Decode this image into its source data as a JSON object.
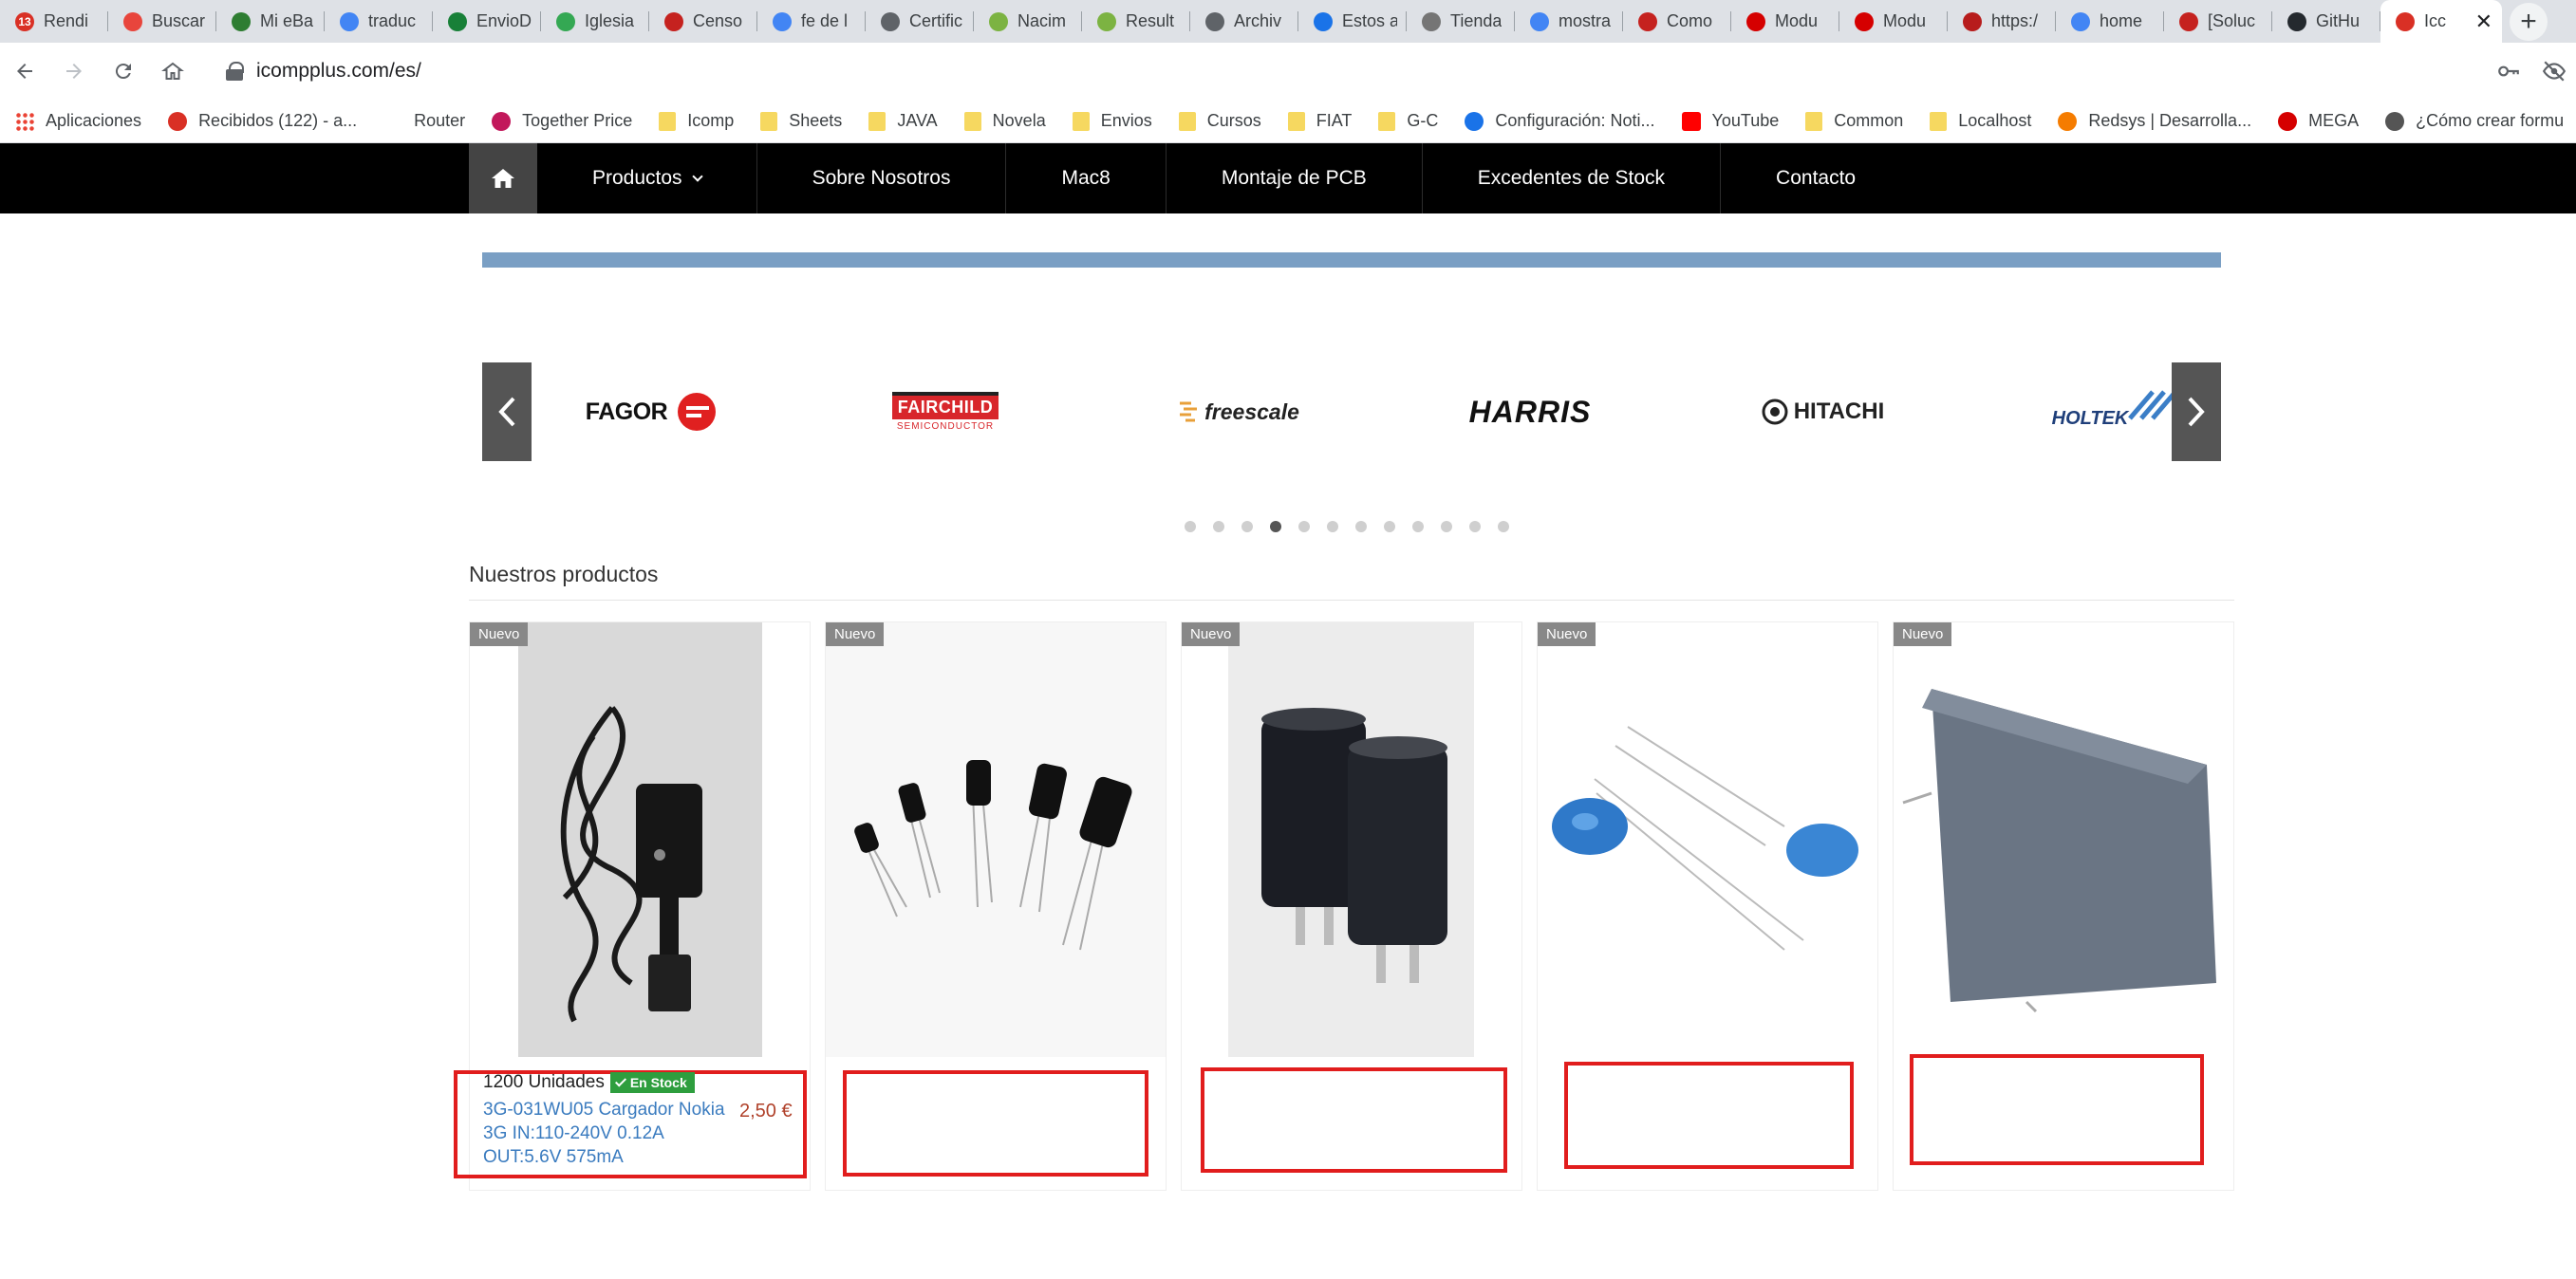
{
  "browser": {
    "tabs": [
      {
        "title": "Rendi",
        "badge": "13",
        "color": "#d93025"
      },
      {
        "title": "Buscar",
        "color": "#e8453c"
      },
      {
        "title": "Mi eBa",
        "color": "#2e7d32"
      },
      {
        "title": "traduc",
        "color": "#4285f4"
      },
      {
        "title": "EnvioD",
        "color": "#188038"
      },
      {
        "title": "Iglesia",
        "color": "#34a853"
      },
      {
        "title": "Censo",
        "color": "#c5221f"
      },
      {
        "title": "fe de l",
        "color": "#4285f4"
      },
      {
        "title": "Certific",
        "color": "#5f6368"
      },
      {
        "title": "Nacim",
        "color": "#7cb342"
      },
      {
        "title": "Result",
        "color": "#7cb342"
      },
      {
        "title": "Archiv",
        "color": "#5f6368"
      },
      {
        "title": "Estos a",
        "color": "#1a73e8"
      },
      {
        "title": "Tienda",
        "color": "#757575"
      },
      {
        "title": "mostra",
        "color": "#4285f4"
      },
      {
        "title": "Como",
        "color": "#c5221f"
      },
      {
        "title": "Modu",
        "color": "#d50000"
      },
      {
        "title": "Modu",
        "color": "#d50000"
      },
      {
        "title": "https:/",
        "color": "#b71c1c"
      },
      {
        "title": "home",
        "color": "#4285f4"
      },
      {
        "title": "[Soluc",
        "color": "#c5221f"
      },
      {
        "title": "GitHu",
        "color": "#24292e"
      },
      {
        "title": "Icc",
        "color": "#d93025",
        "active": true
      }
    ],
    "url": "icompplus.com/es/",
    "bookmarks": [
      {
        "label": "Aplicaciones",
        "icon": "apps-grid-icon"
      },
      {
        "label": "Recibidos (122) - a...",
        "icon": "gmail-icon"
      },
      {
        "label": "Router",
        "icon": "router-icon"
      },
      {
        "label": "Together Price",
        "icon": "together-price-icon"
      },
      {
        "label": "Icomp",
        "icon": "folder-icon"
      },
      {
        "label": "Sheets",
        "icon": "folder-icon"
      },
      {
        "label": "JAVA",
        "icon": "folder-icon"
      },
      {
        "label": "Novela",
        "icon": "folder-icon"
      },
      {
        "label": "Envios",
        "icon": "folder-icon"
      },
      {
        "label": "Cursos",
        "icon": "folder-icon"
      },
      {
        "label": "FIAT",
        "icon": "folder-icon"
      },
      {
        "label": "G-C",
        "icon": "folder-icon"
      },
      {
        "label": "Configuración: Noti...",
        "icon": "gear-icon"
      },
      {
        "label": "YouTube",
        "icon": "youtube-icon"
      },
      {
        "label": "Common",
        "icon": "folder-icon"
      },
      {
        "label": "Localhost",
        "icon": "folder-icon"
      },
      {
        "label": "Redsys | Desarrolla...",
        "icon": "redsys-icon"
      },
      {
        "label": "MEGA",
        "icon": "mega-icon"
      },
      {
        "label": "¿Cómo crear formu",
        "icon": "generic-site-icon"
      }
    ]
  },
  "site": {
    "nav": [
      "Productos",
      "Sobre Nosotros",
      "Mac8",
      "Montaje de PCB",
      "Excedentes de Stock",
      "Contacto"
    ],
    "brands": [
      "FAGOR",
      "FAIRCHILD",
      "SEMICONDUCTOR",
      "freescale",
      "HARRIS",
      "HITACHI",
      "HOLTEK"
    ],
    "carousel_active_dot": 4,
    "carousel_dot_count": 12,
    "section_title": "Nuestros productos",
    "badge_label": "Nuevo",
    "product": {
      "stock": "1200 Unidades",
      "stock_badge": "En Stock",
      "name": "3G-031WU05 Cargador Nokia 3G IN:110-240V 0.12A OUT:5.6V 575mA",
      "price": "2,50 €"
    },
    "colors": {
      "accent_bar": "#7a9fc4",
      "highlight": "#e11d1d",
      "link": "#3a7bbf",
      "price": "#b0412a",
      "stock": "#2e9e3e"
    }
  }
}
